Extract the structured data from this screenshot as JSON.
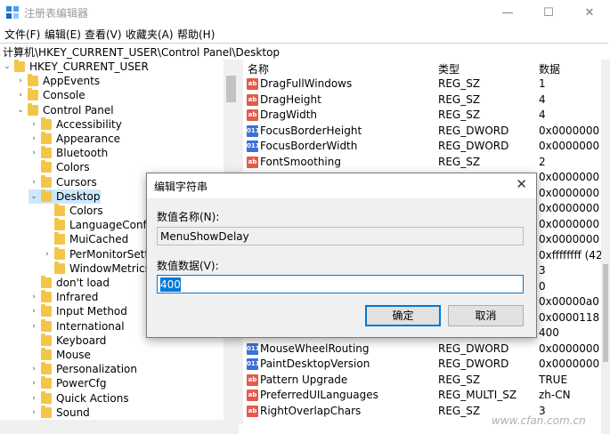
{
  "window": {
    "title": "注册表编辑器",
    "minimize_glyph": "—",
    "maximize_glyph": "☐",
    "close_glyph": "✕"
  },
  "menu": [
    "文件(F)",
    "编辑(E)",
    "查看(V)",
    "收藏夹(A)",
    "帮助(H)"
  ],
  "address": "计算机\\HKEY_CURRENT_USER\\Control Panel\\Desktop",
  "tree": [
    {
      "label": "HKEY_CURRENT_USER",
      "level": 0,
      "state": "expanded"
    },
    {
      "label": "AppEvents",
      "level": 1,
      "state": "collapsed"
    },
    {
      "label": "Console",
      "level": 1,
      "state": "collapsed"
    },
    {
      "label": "Control Panel",
      "level": 1,
      "state": "expanded"
    },
    {
      "label": "Accessibility",
      "level": 2,
      "state": "collapsed"
    },
    {
      "label": "Appearance",
      "level": 2,
      "state": "collapsed"
    },
    {
      "label": "Bluetooth",
      "level": 2,
      "state": "collapsed"
    },
    {
      "label": "Colors",
      "level": 2,
      "state": "none"
    },
    {
      "label": "Cursors",
      "level": 2,
      "state": "collapsed"
    },
    {
      "label": "Desktop",
      "level": 2,
      "state": "expanded",
      "selected": true
    },
    {
      "label": "Colors",
      "level": 3,
      "state": "none"
    },
    {
      "label": "LanguageConfigur",
      "level": 3,
      "state": "none"
    },
    {
      "label": "MuiCached",
      "level": 3,
      "state": "none"
    },
    {
      "label": "PerMonitorSetting",
      "level": 3,
      "state": "collapsed"
    },
    {
      "label": "WindowMetrics",
      "level": 3,
      "state": "none"
    },
    {
      "label": "don't load",
      "level": 2,
      "state": "none"
    },
    {
      "label": "Infrared",
      "level": 2,
      "state": "collapsed"
    },
    {
      "label": "Input Method",
      "level": 2,
      "state": "collapsed"
    },
    {
      "label": "International",
      "level": 2,
      "state": "collapsed"
    },
    {
      "label": "Keyboard",
      "level": 2,
      "state": "none"
    },
    {
      "label": "Mouse",
      "level": 2,
      "state": "none"
    },
    {
      "label": "Personalization",
      "level": 2,
      "state": "collapsed"
    },
    {
      "label": "PowerCfg",
      "level": 2,
      "state": "collapsed"
    },
    {
      "label": "Quick Actions",
      "level": 2,
      "state": "collapsed"
    },
    {
      "label": "Sound",
      "level": 2,
      "state": "collapsed"
    }
  ],
  "columns": {
    "name": "名称",
    "type": "类型",
    "data": "数据"
  },
  "values": [
    {
      "name": "DragFullWindows",
      "type": "REG_SZ",
      "data": "1",
      "icon": "ab"
    },
    {
      "name": "DragHeight",
      "type": "REG_SZ",
      "data": "4",
      "icon": "ab"
    },
    {
      "name": "DragWidth",
      "type": "REG_SZ",
      "data": "4",
      "icon": "ab"
    },
    {
      "name": "FocusBorderHeight",
      "type": "REG_DWORD",
      "data": "0x0000000",
      "icon": "dw"
    },
    {
      "name": "FocusBorderWidth",
      "type": "REG_DWORD",
      "data": "0x0000000",
      "icon": "dw"
    },
    {
      "name": "FontSmoothing",
      "type": "REG_SZ",
      "data": "2",
      "icon": "ab"
    },
    {
      "name": "",
      "type": "",
      "data": "0x0000000",
      "icon": ""
    },
    {
      "name": "",
      "type": "",
      "data": "0x0000000",
      "icon": ""
    },
    {
      "name": "",
      "type": "",
      "data": "0x0000000",
      "icon": ""
    },
    {
      "name": "",
      "type": "",
      "data": "0x0000000",
      "icon": ""
    },
    {
      "name": "",
      "type": "",
      "data": "0x0000000",
      "icon": ""
    },
    {
      "name": "",
      "type": "",
      "data": "0xffffffff (42",
      "icon": ""
    },
    {
      "name": "",
      "type": "",
      "data": "3",
      "icon": ""
    },
    {
      "name": "",
      "type": "",
      "data": "0",
      "icon": ""
    },
    {
      "name": "",
      "type": "",
      "data": "0x00000a0",
      "icon": ""
    },
    {
      "name": "",
      "type": "",
      "data": "0x0000118",
      "icon": ""
    },
    {
      "name": "",
      "type": "",
      "data": "400",
      "icon": ""
    },
    {
      "name": "MouseWheelRouting",
      "type": "REG_DWORD",
      "data": "0x0000000",
      "icon": "dw"
    },
    {
      "name": "PaintDesktopVersion",
      "type": "REG_DWORD",
      "data": "0x0000000",
      "icon": "dw"
    },
    {
      "name": "Pattern Upgrade",
      "type": "REG_SZ",
      "data": "TRUE",
      "icon": "ab"
    },
    {
      "name": "PreferredUILanguages",
      "type": "REG_MULTI_SZ",
      "data": "zh-CN",
      "icon": "ab"
    },
    {
      "name": "RightOverlapChars",
      "type": "REG_SZ",
      "data": "3",
      "icon": "ab"
    }
  ],
  "dialog": {
    "title": "编辑字符串",
    "close_glyph": "✕",
    "name_label": "数值名称(N):",
    "name_value": "MenuShowDelay",
    "data_label": "数值数据(V):",
    "data_value": "400",
    "ok_label": "确定",
    "cancel_label": "取消"
  },
  "watermark": "www.cfan.com.cn"
}
